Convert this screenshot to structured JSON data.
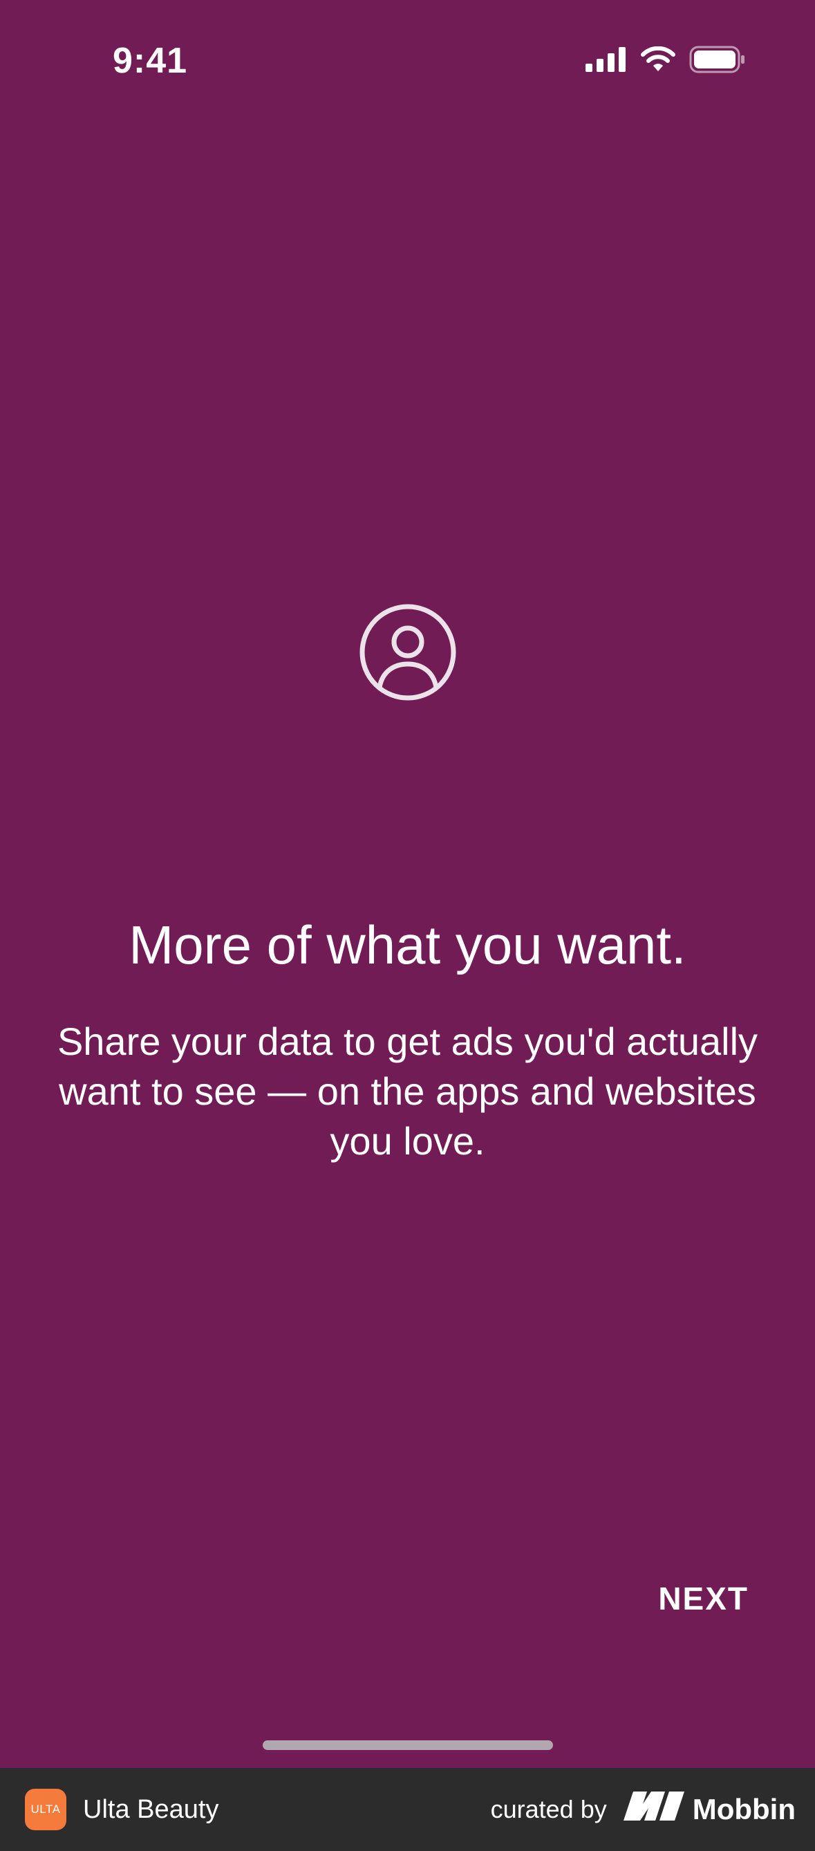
{
  "status_bar": {
    "time": "9:41",
    "icons": [
      "signal-icon",
      "wifi-icon",
      "battery-icon"
    ]
  },
  "main": {
    "icon": "profile-icon",
    "headline": "More of what you want.",
    "subtitle": "Share your data to get ads you'd actually want to see — on the apps and websites you love.",
    "next_label": "NEXT"
  },
  "footer": {
    "app_logo_text": "ULTA",
    "app_name": "Ulta Beauty",
    "curated_label": "curated by",
    "brand": "Mobbin"
  },
  "colors": {
    "background": "#711c55",
    "text": "#ffffff",
    "footer_bg": "#2c2c2c",
    "logo_bg": "#f47b3c"
  }
}
